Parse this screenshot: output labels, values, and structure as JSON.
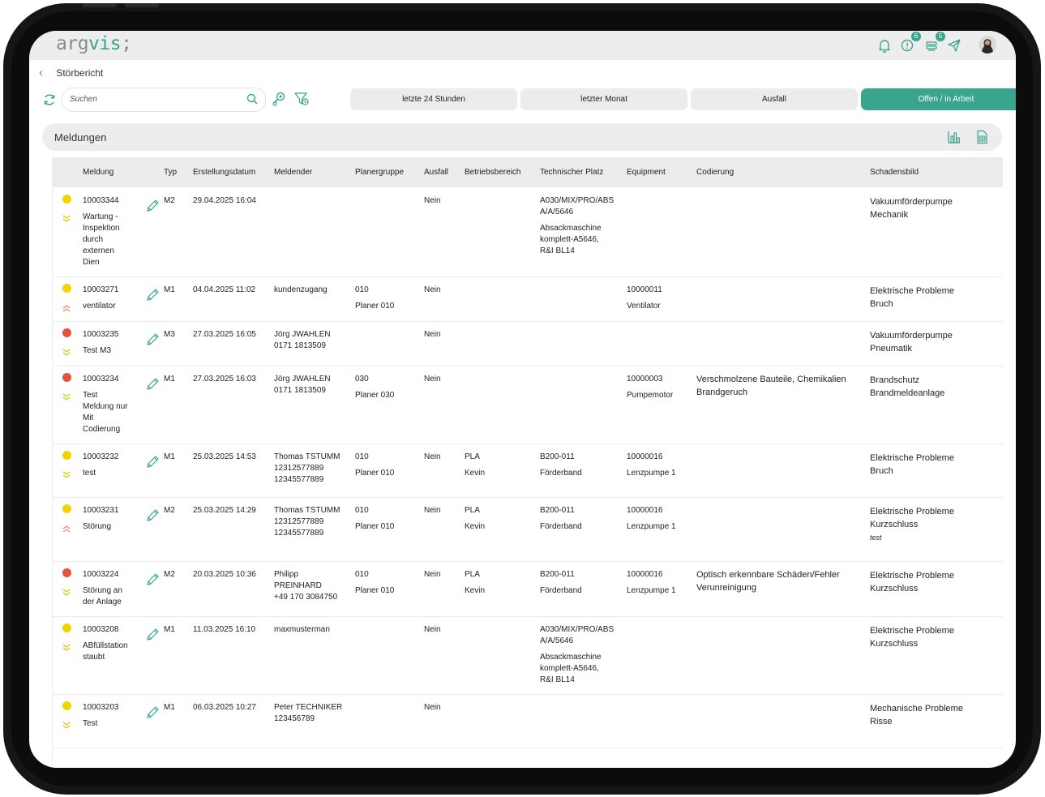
{
  "app": {
    "logo_a": "arg",
    "logo_b": "vis",
    "logo_c": ";",
    "badge_alerts": "6",
    "badge_messages": "5"
  },
  "breadcrumb": {
    "title": "Störbericht"
  },
  "search": {
    "placeholder": "Suchen"
  },
  "filters": [
    "letzte 24 Stunden",
    "letzter Monat",
    "Ausfall",
    "Offen / in Arbeit"
  ],
  "panel": {
    "title": "Meldungen"
  },
  "columns": [
    "Meldung",
    "Typ",
    "Erstellungsdatum",
    "Meldender",
    "Planergruppe",
    "Ausfall",
    "Betriebsbereich",
    "Technischer Platz",
    "Equipment",
    "Codierung",
    "Schadensbild"
  ],
  "colors": {
    "accent": "#3aa58f",
    "status_yellow": "#f2d300",
    "status_red": "#e5533d"
  },
  "rows": [
    {
      "status": "yellow",
      "prio": "low",
      "id": "10003344",
      "text": "Wartung -\nInspektion\ndurch\nexternen\nDien",
      "typ": "M2",
      "date": "29.04.2025 16:04",
      "melder": "",
      "planer": "",
      "planer2": "",
      "ausfall": "Nein",
      "bereich": "",
      "bereich2": "",
      "platz": "A030/MIX/PRO/ABS\nA/A/5646",
      "platz2": "Absackmaschine\nkomplett-A5646,\nR&I BL14",
      "equip": "",
      "equip2": "",
      "cod": "",
      "schaden": "Vakuumförderpumpe\nMechanik",
      "schaden_note": ""
    },
    {
      "status": "yellow",
      "prio": "high",
      "id": "10003271",
      "text": "ventilator",
      "typ": "M1",
      "date": "04.04.2025 11:02",
      "melder": "kundenzugang",
      "planer": "010",
      "planer2": "Planer 010",
      "ausfall": "Nein",
      "bereich": "",
      "bereich2": "",
      "platz": "",
      "platz2": "",
      "equip": "10000011",
      "equip2": "Ventilator",
      "cod": "",
      "schaden": "Elektrische Probleme\nBruch",
      "schaden_note": ""
    },
    {
      "status": "red",
      "prio": "low",
      "id": "10003235",
      "text": "Test M3",
      "typ": "M3",
      "date": "27.03.2025 16:05",
      "melder": "Jörg JWAHLEN\n0171 1813509",
      "planer": "",
      "planer2": "",
      "ausfall": "Nein",
      "bereich": "",
      "bereich2": "",
      "platz": "",
      "platz2": "",
      "equip": "",
      "equip2": "",
      "cod": "",
      "schaden": "Vakuumförderpumpe\nPneumatik",
      "schaden_note": ""
    },
    {
      "status": "red",
      "prio": "low",
      "id": "10003234",
      "text": "Test\nMeldung nur\nMit\nCodierung",
      "typ": "M1",
      "date": "27.03.2025 16:03",
      "melder": "Jörg JWAHLEN\n0171 1813509",
      "planer": "030",
      "planer2": "Planer 030",
      "ausfall": "Nein",
      "bereich": "",
      "bereich2": "",
      "platz": "",
      "platz2": "",
      "equip": "10000003",
      "equip2": "Pumpemotor",
      "cod": "Verschmolzene Bauteile, Chemikalien\nBrandgeruch",
      "schaden": "Brandschutz\nBrandmeldeanlage",
      "schaden_note": ""
    },
    {
      "status": "yellow",
      "prio": "low",
      "id": "10003232",
      "text": "test",
      "typ": "M1",
      "date": "25.03.2025 14:53",
      "melder": "Thomas TSTUMM\n12312577889\n12345577889",
      "planer": "010",
      "planer2": "Planer 010",
      "ausfall": "Nein",
      "bereich": "PLA",
      "bereich2": "Kevin",
      "platz": "B200-011",
      "platz2": "Förderband",
      "equip": "10000016",
      "equip2": "Lenzpumpe 1",
      "cod": "",
      "schaden": "Elektrische Probleme\nBruch",
      "schaden_note": ""
    },
    {
      "status": "yellow",
      "prio": "high",
      "id": "10003231",
      "text": "Störung",
      "typ": "M2",
      "date": "25.03.2025 14:29",
      "melder": "Thomas TSTUMM\n12312577889\n12345577889",
      "planer": "010",
      "planer2": "Planer 010",
      "ausfall": "Nein",
      "bereich": "PLA",
      "bereich2": "Kevin",
      "platz": "B200-011",
      "platz2": "Förderband",
      "equip": "10000016",
      "equip2": "Lenzpumpe 1",
      "cod": "",
      "schaden": "Elektrische Probleme\nKurzschluss",
      "schaden_note": "test"
    },
    {
      "status": "red",
      "prio": "low",
      "id": "10003224",
      "text": "Störung an\nder Anlage",
      "typ": "M2",
      "date": "20.03.2025 10:36",
      "melder": "Philipp\nPREINHARD\n+49 170 3084750",
      "planer": "010",
      "planer2": "Planer 010",
      "ausfall": "Nein",
      "bereich": "PLA",
      "bereich2": "Kevin",
      "platz": "B200-011",
      "platz2": "Förderband",
      "equip": "10000016",
      "equip2": "Lenzpumpe 1",
      "cod": "Optisch erkennbare Schäden/Fehler\nVerunreinigung",
      "schaden": "Elektrische Probleme\nKurzschluss",
      "schaden_note": ""
    },
    {
      "status": "yellow",
      "prio": "low",
      "id": "10003208",
      "text": "ABfüllstation\nstaubt",
      "typ": "M1",
      "date": "11.03.2025 16:10",
      "melder": "maxmusterman",
      "planer": "",
      "planer2": "",
      "ausfall": "Nein",
      "bereich": "",
      "bereich2": "",
      "platz": "A030/MIX/PRO/ABS\nA/A/5646",
      "platz2": "Absackmaschine\nkomplett-A5646,\nR&I BL14",
      "equip": "",
      "equip2": "",
      "cod": "",
      "schaden": "Elektrische Probleme\nKurzschluss",
      "schaden_note": ""
    },
    {
      "status": "yellow",
      "prio": "low",
      "id": "10003203",
      "text": "Test",
      "typ": "M1",
      "date": "06.03.2025 10:27",
      "melder": "Peter TECHNIKER\n123456789",
      "planer": "",
      "planer2": "",
      "ausfall": "Nein",
      "bereich": "",
      "bereich2": "",
      "platz": "",
      "platz2": "",
      "equip": "",
      "equip2": "",
      "cod": "",
      "schaden": "Mechanische Probleme\nRisse",
      "schaden_note": ""
    }
  ]
}
